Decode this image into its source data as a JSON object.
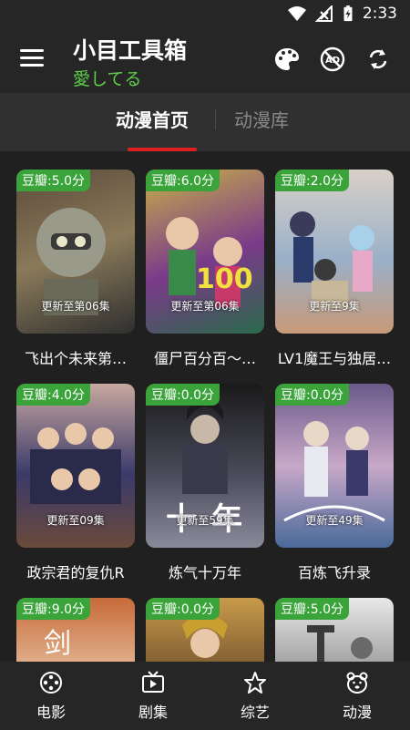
{
  "status": {
    "time": "2:33"
  },
  "header": {
    "title": "小目工具箱",
    "subtitle": "愛してる"
  },
  "tabs": [
    {
      "label": "动漫首页"
    },
    {
      "label": "动漫库"
    }
  ],
  "cards": [
    {
      "rating": "豆瓣:5.0分",
      "update": "更新至第06集",
      "title": "飞出个未来第…",
      "colors": [
        "#5b4a3a",
        "#8a7a5a",
        "#2f2f2f"
      ]
    },
    {
      "rating": "豆瓣:6.0分",
      "update": "更新至第06集",
      "title": "僵尸百分百～…",
      "colors": [
        "#c8b048",
        "#7a3a8a",
        "#2a6a4a"
      ]
    },
    {
      "rating": "豆瓣:2.0分",
      "update": "更新至9集",
      "title": "LV1魔王与独居…",
      "colors": [
        "#d8d0c8",
        "#9ab0c8",
        "#c89a7a"
      ]
    },
    {
      "rating": "豆瓣:4.0分",
      "update": "更新至09集",
      "title": "政宗君的复仇R",
      "colors": [
        "#c8a8a0",
        "#3a3a6a",
        "#6a4a3a"
      ]
    },
    {
      "rating": "豆瓣:0.0分",
      "update": "更新至59集",
      "title": "炼气十万年",
      "colors": [
        "#1a1a1a",
        "#4a4a5a",
        "#8a8a9a"
      ]
    },
    {
      "rating": "豆瓣:0.0分",
      "update": "更新至49集",
      "title": "百炼飞升录",
      "colors": [
        "#6a5a8a",
        "#c8a8c8",
        "#4a6a9a"
      ]
    },
    {
      "rating": "豆瓣:9.0分",
      "update": "",
      "title": "",
      "colors": [
        "#c86a3a",
        "#e8c8a8",
        "#8a3a2a"
      ]
    },
    {
      "rating": "豆瓣:0.0分",
      "update": "",
      "title": "",
      "colors": [
        "#c89a4a",
        "#6a4a2a",
        "#e8c88a"
      ]
    },
    {
      "rating": "豆瓣:5.0分",
      "update": "",
      "title": "",
      "colors": [
        "#e8e8e8",
        "#8a8a8a",
        "#4a4a4a"
      ]
    }
  ],
  "bottom_nav": [
    {
      "label": "电影",
      "icon": "film-reel-icon"
    },
    {
      "label": "剧集",
      "icon": "tv-icon"
    },
    {
      "label": "综艺",
      "icon": "star-icon"
    },
    {
      "label": "动漫",
      "icon": "bear-icon"
    }
  ]
}
